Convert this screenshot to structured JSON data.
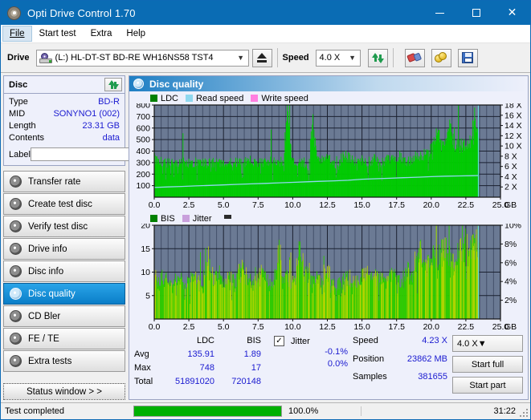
{
  "window": {
    "title": "Opti Drive Control 1.70",
    "icon": "disc-icon",
    "buttons": {
      "minimize": "—",
      "maximize": "☐",
      "close": "✕"
    }
  },
  "menu": {
    "items": [
      "File",
      "Start test",
      "Extra",
      "Help"
    ],
    "active": "File"
  },
  "toolbar": {
    "drive_label": "Drive",
    "drive_value": "(L:)  HL-DT-ST BD-RE  WH16NS58 TST4",
    "eject_icon": "eject-icon",
    "speed_label": "Speed",
    "speed_value": "4.0 X",
    "refresh_icon": "refresh-icon",
    "erase_icon": "eraser-icon",
    "coins_icon": "coins-icon",
    "save_icon": "floppy-save-icon"
  },
  "disc_panel": {
    "title": "Disc",
    "refresh_icon": "refresh-icon",
    "rows": [
      {
        "key": "Type",
        "value": "BD-R"
      },
      {
        "key": "MID",
        "value": "SONYNO1 (002)"
      },
      {
        "key": "Length",
        "value": "23.31 GB"
      },
      {
        "key": "Contents",
        "value": "data"
      }
    ],
    "label_key": "Label",
    "label_value": "",
    "label_placeholder": "",
    "label_button_icon": "cd-icon"
  },
  "sidebar": {
    "items": [
      {
        "label": "Transfer rate",
        "icon": "disc-icon",
        "selected": false
      },
      {
        "label": "Create test disc",
        "icon": "disc-icon",
        "selected": false
      },
      {
        "label": "Verify test disc",
        "icon": "disc-icon",
        "selected": false
      },
      {
        "label": "Drive info",
        "icon": "disc-icon",
        "selected": false
      },
      {
        "label": "Disc info",
        "icon": "disc-icon",
        "selected": false
      },
      {
        "label": "Disc quality",
        "icon": "disc-icon",
        "selected": true
      },
      {
        "label": "CD Bler",
        "icon": "disc-icon",
        "selected": false
      },
      {
        "label": "FE / TE",
        "icon": "disc-icon",
        "selected": false
      },
      {
        "label": "Extra tests",
        "icon": "disc-icon",
        "selected": false
      }
    ],
    "status_window_button": "Status window > >"
  },
  "main": {
    "title": "Disc quality",
    "icon": "disc-icon"
  },
  "stats": {
    "columns": [
      "LDC",
      "BIS"
    ],
    "rows": [
      {
        "name": "Avg",
        "ldc": "135.91",
        "bis": "1.89"
      },
      {
        "name": "Max",
        "ldc": "748",
        "bis": "17"
      },
      {
        "name": "Total",
        "ldc": "51891020",
        "bis": "720148"
      }
    ],
    "jitter": {
      "label": "Jitter",
      "checked": true,
      "check_glyph": "✓",
      "avg": "-0.1%",
      "max": "0.0%"
    },
    "speed_key": "Speed",
    "speed_value": "4.23 X",
    "position_key": "Position",
    "position_value": "23862 MB",
    "samples_key": "Samples",
    "samples_value": "381655",
    "speed_select": "4.0 X",
    "start_full": "Start full",
    "start_part": "Start part"
  },
  "statusbar": {
    "message": "Test completed",
    "progress_pct": "100.0%",
    "progress_value": 100,
    "elapsed": "31:22"
  },
  "colors": {
    "accent": "#0a6cb4",
    "plot_bg": "#6b7a94",
    "ldc_green": "#00cc00",
    "ldc_legend": "#008000",
    "read_speed": "#8fd8ef",
    "write_speed": "#ff7fe0",
    "bis_green": "#2ecc00",
    "jitter": "#c9a0dc",
    "value_text": "#1a1ad0",
    "progress_green": "#00b000"
  },
  "chart_data": [
    {
      "id": "ldc-chart",
      "type": "area",
      "title": "Disc quality",
      "xlabel": "GB",
      "ylabel": "LDC",
      "xlim": [
        0,
        25
      ],
      "ylim": [
        0,
        800
      ],
      "y2lim": [
        0,
        18
      ],
      "y2label": "X",
      "grid": true,
      "legend": [
        "LDC",
        "Read speed",
        "Write speed"
      ],
      "legend_position": "top-left",
      "xticks": [
        "0.0",
        "2.5",
        "5.0",
        "7.5",
        "10.0",
        "12.5",
        "15.0",
        "17.5",
        "20.0",
        "22.5",
        "25.0"
      ],
      "yticks": [
        "100",
        "200",
        "300",
        "400",
        "500",
        "600",
        "700",
        "800"
      ],
      "y2ticks": [
        "2 X",
        "4 X",
        "6 X",
        "8 X",
        "10 X",
        "12 X",
        "14 X",
        "16 X",
        "18 X"
      ],
      "series": [
        {
          "name": "LDC",
          "color": "#00cc00",
          "x": [
            0.0,
            0.3,
            0.6,
            0.9,
            1.2,
            1.5,
            1.8,
            2.1,
            2.4,
            2.7,
            3.0,
            3.3,
            3.6,
            3.9,
            4.2,
            4.5,
            4.8,
            5.1,
            5.4,
            5.7,
            6.0,
            6.3,
            6.6,
            6.9,
            7.2,
            7.5,
            7.8,
            8.1,
            8.4,
            8.7,
            9.0,
            9.3,
            9.6,
            9.9,
            10.2,
            10.5,
            10.8,
            11.1,
            11.4,
            11.7,
            12.0,
            12.3,
            12.6,
            12.9,
            13.2,
            13.5,
            13.8,
            14.1,
            14.4,
            14.7,
            15.0,
            15.3,
            15.6,
            15.9,
            16.2,
            16.5,
            16.8,
            17.1,
            17.4,
            17.7,
            18.0,
            18.3,
            18.6,
            18.9,
            19.2,
            19.5,
            19.8,
            20.1,
            20.4,
            20.7,
            21.0,
            21.3,
            21.6,
            21.9,
            22.2,
            22.5,
            22.8,
            23.1,
            23.4
          ],
          "values": [
            330,
            300,
            310,
            290,
            300,
            305,
            295,
            300,
            290,
            295,
            300,
            290,
            295,
            285,
            300,
            295,
            290,
            300,
            290,
            295,
            300,
            290,
            300,
            310,
            295,
            290,
            300,
            300,
            310,
            305,
            300,
            310,
            750,
            300,
            300,
            290,
            300,
            210,
            660,
            330,
            310,
            330,
            320,
            300,
            230,
            340,
            350,
            330,
            300,
            300,
            320,
            300,
            310,
            330,
            290,
            300,
            330,
            320,
            340,
            350,
            320,
            300,
            330,
            350,
            360,
            370,
            380,
            420,
            600,
            430,
            440,
            710,
            450,
            430,
            440,
            450,
            470,
            690,
            500
          ]
        },
        {
          "name": "Read speed",
          "color": "#8fd8ef",
          "x": [
            0.0,
            1.0,
            2.0,
            3.0,
            4.0,
            5.0,
            6.0,
            7.0,
            8.0,
            9.0,
            10.0,
            11.0,
            12.0,
            13.0,
            14.0,
            15.0,
            16.0,
            17.0,
            18.0,
            19.0,
            20.0,
            21.0,
            22.0,
            23.0,
            23.4
          ],
          "values": [
            1.9,
            2.0,
            2.1,
            2.2,
            2.3,
            2.4,
            2.5,
            2.6,
            2.7,
            2.8,
            2.9,
            3.0,
            3.1,
            3.2,
            3.3,
            3.5,
            3.6,
            3.7,
            3.8,
            3.9,
            4.0,
            4.1,
            4.15,
            4.2,
            4.23
          ]
        },
        {
          "name": "Write speed",
          "color": "#ff7fe0",
          "x": [],
          "values": []
        }
      ]
    },
    {
      "id": "bis-jitter-chart",
      "type": "area",
      "xlabel": "GB",
      "ylabel": "BIS",
      "xlim": [
        0,
        25
      ],
      "ylim": [
        0,
        20
      ],
      "y2lim": [
        0,
        10
      ],
      "y2label": "%",
      "grid": true,
      "legend": [
        "BIS",
        "Jitter"
      ],
      "legend_position": "top-left",
      "xticks": [
        "0.0",
        "2.5",
        "5.0",
        "7.5",
        "10.0",
        "12.5",
        "15.0",
        "17.5",
        "20.0",
        "22.5",
        "25.0"
      ],
      "yticks": [
        "5",
        "10",
        "15",
        "20"
      ],
      "y2ticks": [
        "2%",
        "4%",
        "6%",
        "8%",
        "10%"
      ],
      "series": [
        {
          "name": "BIS",
          "color": "#2ecc00",
          "x": [
            0.0,
            0.3,
            0.6,
            0.9,
            1.2,
            1.5,
            1.8,
            2.1,
            2.4,
            2.7,
            3.0,
            3.3,
            3.6,
            3.9,
            4.2,
            4.5,
            4.8,
            5.1,
            5.4,
            5.7,
            6.0,
            6.3,
            6.6,
            6.9,
            7.2,
            7.5,
            7.8,
            8.1,
            8.4,
            8.7,
            9.0,
            9.3,
            9.6,
            9.9,
            10.2,
            10.5,
            10.8,
            11.1,
            11.4,
            11.7,
            12.0,
            12.3,
            12.6,
            12.9,
            13.2,
            13.5,
            13.8,
            14.1,
            14.4,
            14.7,
            15.0,
            15.3,
            15.6,
            15.9,
            16.2,
            16.5,
            16.8,
            17.1,
            17.4,
            17.7,
            18.0,
            18.3,
            18.6,
            18.9,
            19.2,
            19.5,
            19.8,
            20.1,
            20.4,
            20.7,
            21.0,
            21.3,
            21.6,
            21.9,
            22.2,
            22.5,
            22.8,
            23.1,
            23.4
          ],
          "values": [
            7,
            8,
            9,
            8,
            7,
            8,
            9,
            7,
            8,
            9,
            8,
            7,
            9,
            12,
            8,
            9,
            8,
            7,
            9,
            8,
            9,
            11,
            8,
            9,
            7,
            8,
            9,
            8,
            7,
            9,
            14,
            8,
            9,
            7,
            8,
            14,
            9,
            10,
            8,
            9,
            7,
            8,
            9,
            7,
            8,
            7,
            9,
            8,
            7,
            8,
            9,
            8,
            10,
            9,
            8,
            9,
            8,
            10,
            9,
            8,
            9,
            10,
            9,
            11,
            14,
            10,
            12,
            13,
            12,
            14,
            15,
            13,
            12,
            14,
            13,
            17,
            16,
            15,
            14
          ]
        },
        {
          "name": "Jitter",
          "color": "#c9a0dc",
          "x": [],
          "values": []
        }
      ]
    }
  ]
}
